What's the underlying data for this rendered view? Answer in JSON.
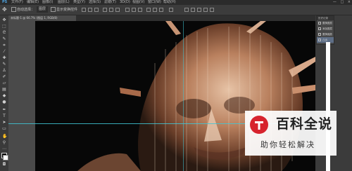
{
  "menubar": {
    "items": [
      "PS",
      "文件(F)",
      "编辑(E)",
      "图像(I)",
      "图层(L)",
      "类型(Y)",
      "选择(S)",
      "滤镜(T)",
      "3D(D)",
      "视图(V)",
      "窗口(W)",
      "帮助(H)"
    ],
    "window_controls": [
      "—",
      "□",
      "×"
    ]
  },
  "options": {
    "auto_select_label": "自动选择：",
    "auto_select_value": "图层",
    "show_transform_label": "显示变换控件"
  },
  "document": {
    "tab_label": "未标题-1 @ 66.7% (图层 1, RGB/8)"
  },
  "history": {
    "title": "历史记录",
    "items": [
      "置换图层",
      "添加图层",
      "置换缩放",
      "凸出"
    ],
    "active_index": 3
  },
  "watermark": {
    "title": "百科全说",
    "subtitle": "助你轻松解决",
    "brand_color": "#d7232d"
  },
  "colors": {
    "guide": "#3fc7d6",
    "menubar": "#2b2b2b",
    "workspace": "#535353"
  },
  "icons": {
    "tools": [
      "move-icon",
      "marquee-icon",
      "lasso-icon",
      "quick-select-icon",
      "crop-icon",
      "eyedropper-icon",
      "healing-icon",
      "brush-icon",
      "stamp-icon",
      "history-brush-icon",
      "eraser-icon",
      "gradient-icon",
      "blur-icon",
      "dodge-icon",
      "pen-icon",
      "type-icon",
      "path-select-icon",
      "shape-icon",
      "hand-icon",
      "zoom-icon"
    ]
  }
}
